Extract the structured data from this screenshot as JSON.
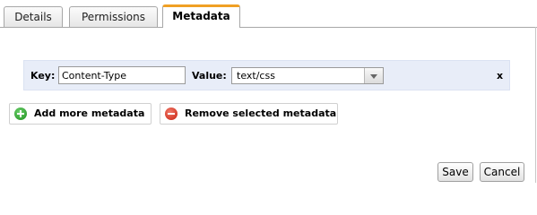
{
  "tabs": [
    {
      "label": "Details",
      "active": false
    },
    {
      "label": "Permissions",
      "active": false
    },
    {
      "label": "Metadata",
      "active": true
    }
  ],
  "metadata_row": {
    "key_label": "Key:",
    "key_value": "Content-Type",
    "value_label": "Value:",
    "value_selected": "text/css",
    "remove_label": "x"
  },
  "actions": {
    "add_label": "Add more metadata",
    "remove_label": "Remove selected metadata"
  },
  "footer": {
    "save_label": "Save",
    "cancel_label": "Cancel"
  },
  "colors": {
    "active_tab_accent": "#f0a024",
    "row_background": "#e8edf8",
    "add_icon": "#1f8f1f",
    "remove_icon": "#c8200e"
  }
}
